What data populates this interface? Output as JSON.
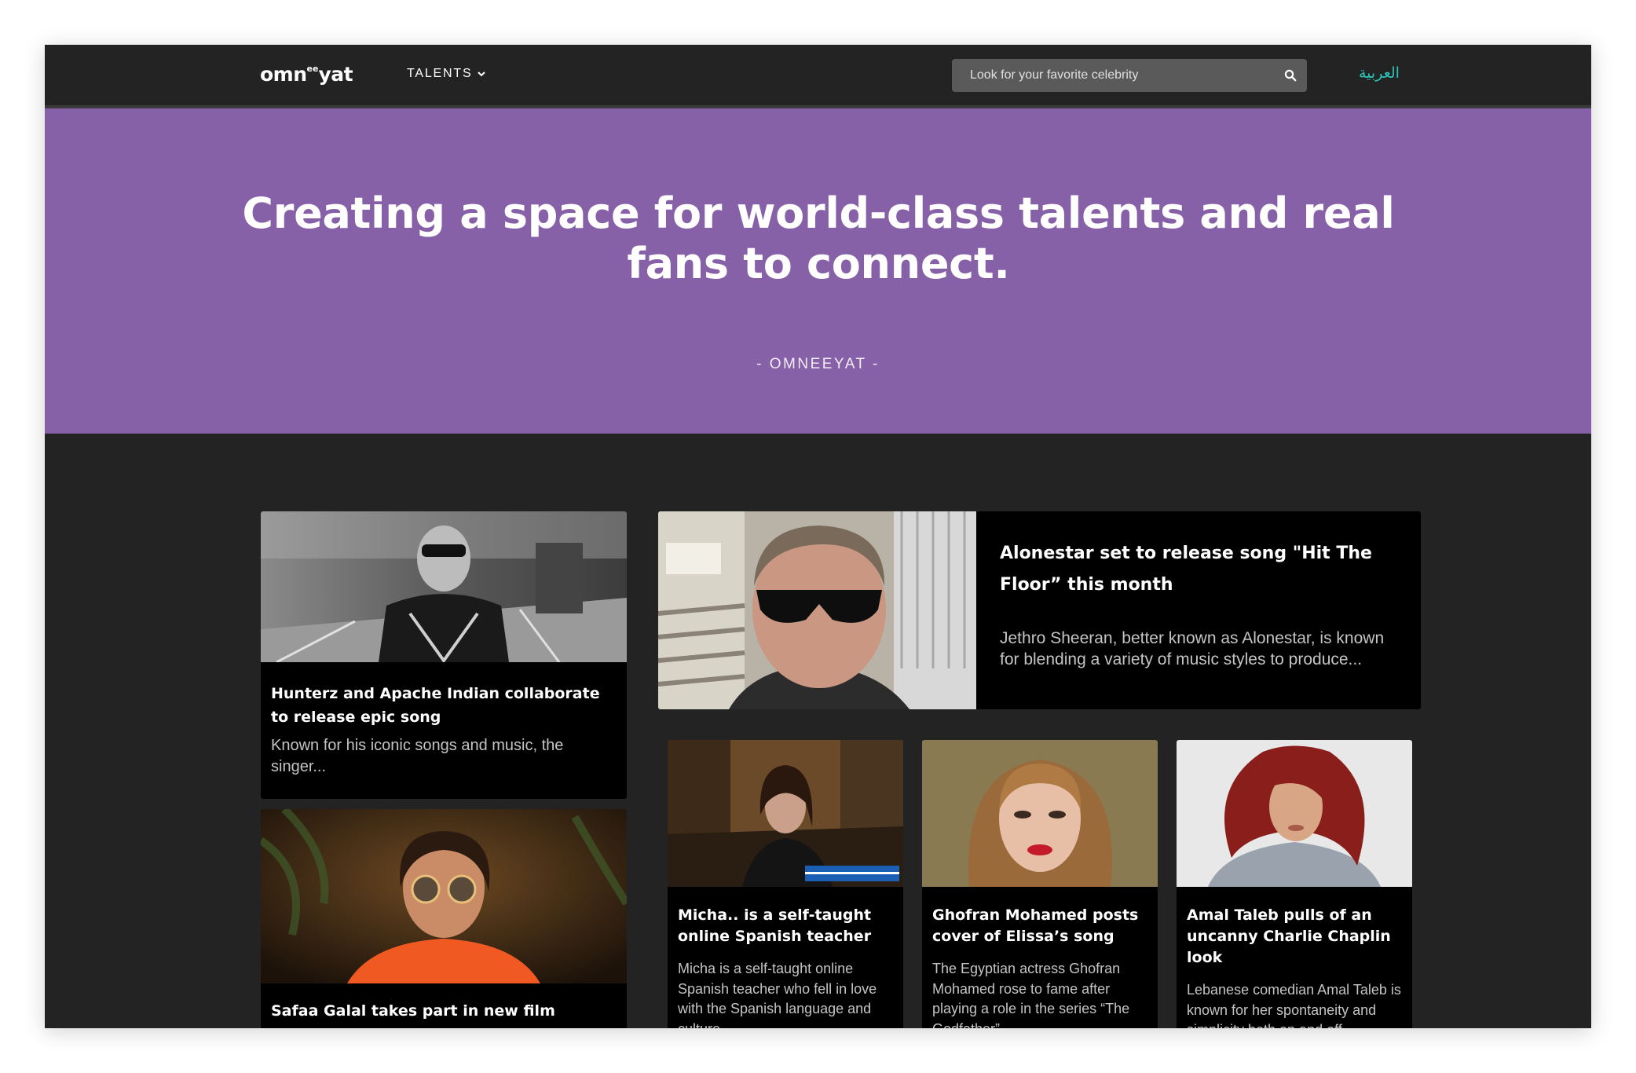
{
  "nav": {
    "logo_main": "omn",
    "logo_sup": "ee",
    "logo_end": "yat",
    "talents_label": "TALENTS",
    "search_placeholder": "Look for your favorite celebrity",
    "language_label": "العربية"
  },
  "hero": {
    "headline": "Creating a space for world-class talents and real fans to connect.",
    "brand": "- OMNEEYAT -",
    "background": "#8761a8"
  },
  "colors": {
    "accent": "#2ec3b9",
    "page_bg": "#232323",
    "card_bg": "#000000"
  },
  "articles": [
    {
      "title": "Hunterz and Apache Indian collaborate to release epic song",
      "excerpt": "Known for his iconic songs and music, the singer..."
    },
    {
      "title": "Safaa Galal takes part in new film",
      "excerpt": ""
    },
    {
      "title": "Alonestar set to release song \"Hit The Floor” this month",
      "excerpt": "Jethro Sheeran, better known as Alonestar, is known for blending a variety of music styles to produce..."
    },
    {
      "title": "Micha.. is a self-taught online Spanish teacher",
      "excerpt": "Micha is a self-taught online Spanish teacher who fell in love with the Spanish language and culture..."
    },
    {
      "title": "Ghofran Mohamed posts cover of Elissa’s song",
      "excerpt": "The Egyptian actress Ghofran Mohamed rose to fame after playing a role in the series “The Godfather”..."
    },
    {
      "title": "Amal Taleb pulls of an uncanny Charlie Chaplin look",
      "excerpt": "Lebanese comedian Amal Taleb is known for her spontaneity and simplicity both on and off..."
    }
  ]
}
